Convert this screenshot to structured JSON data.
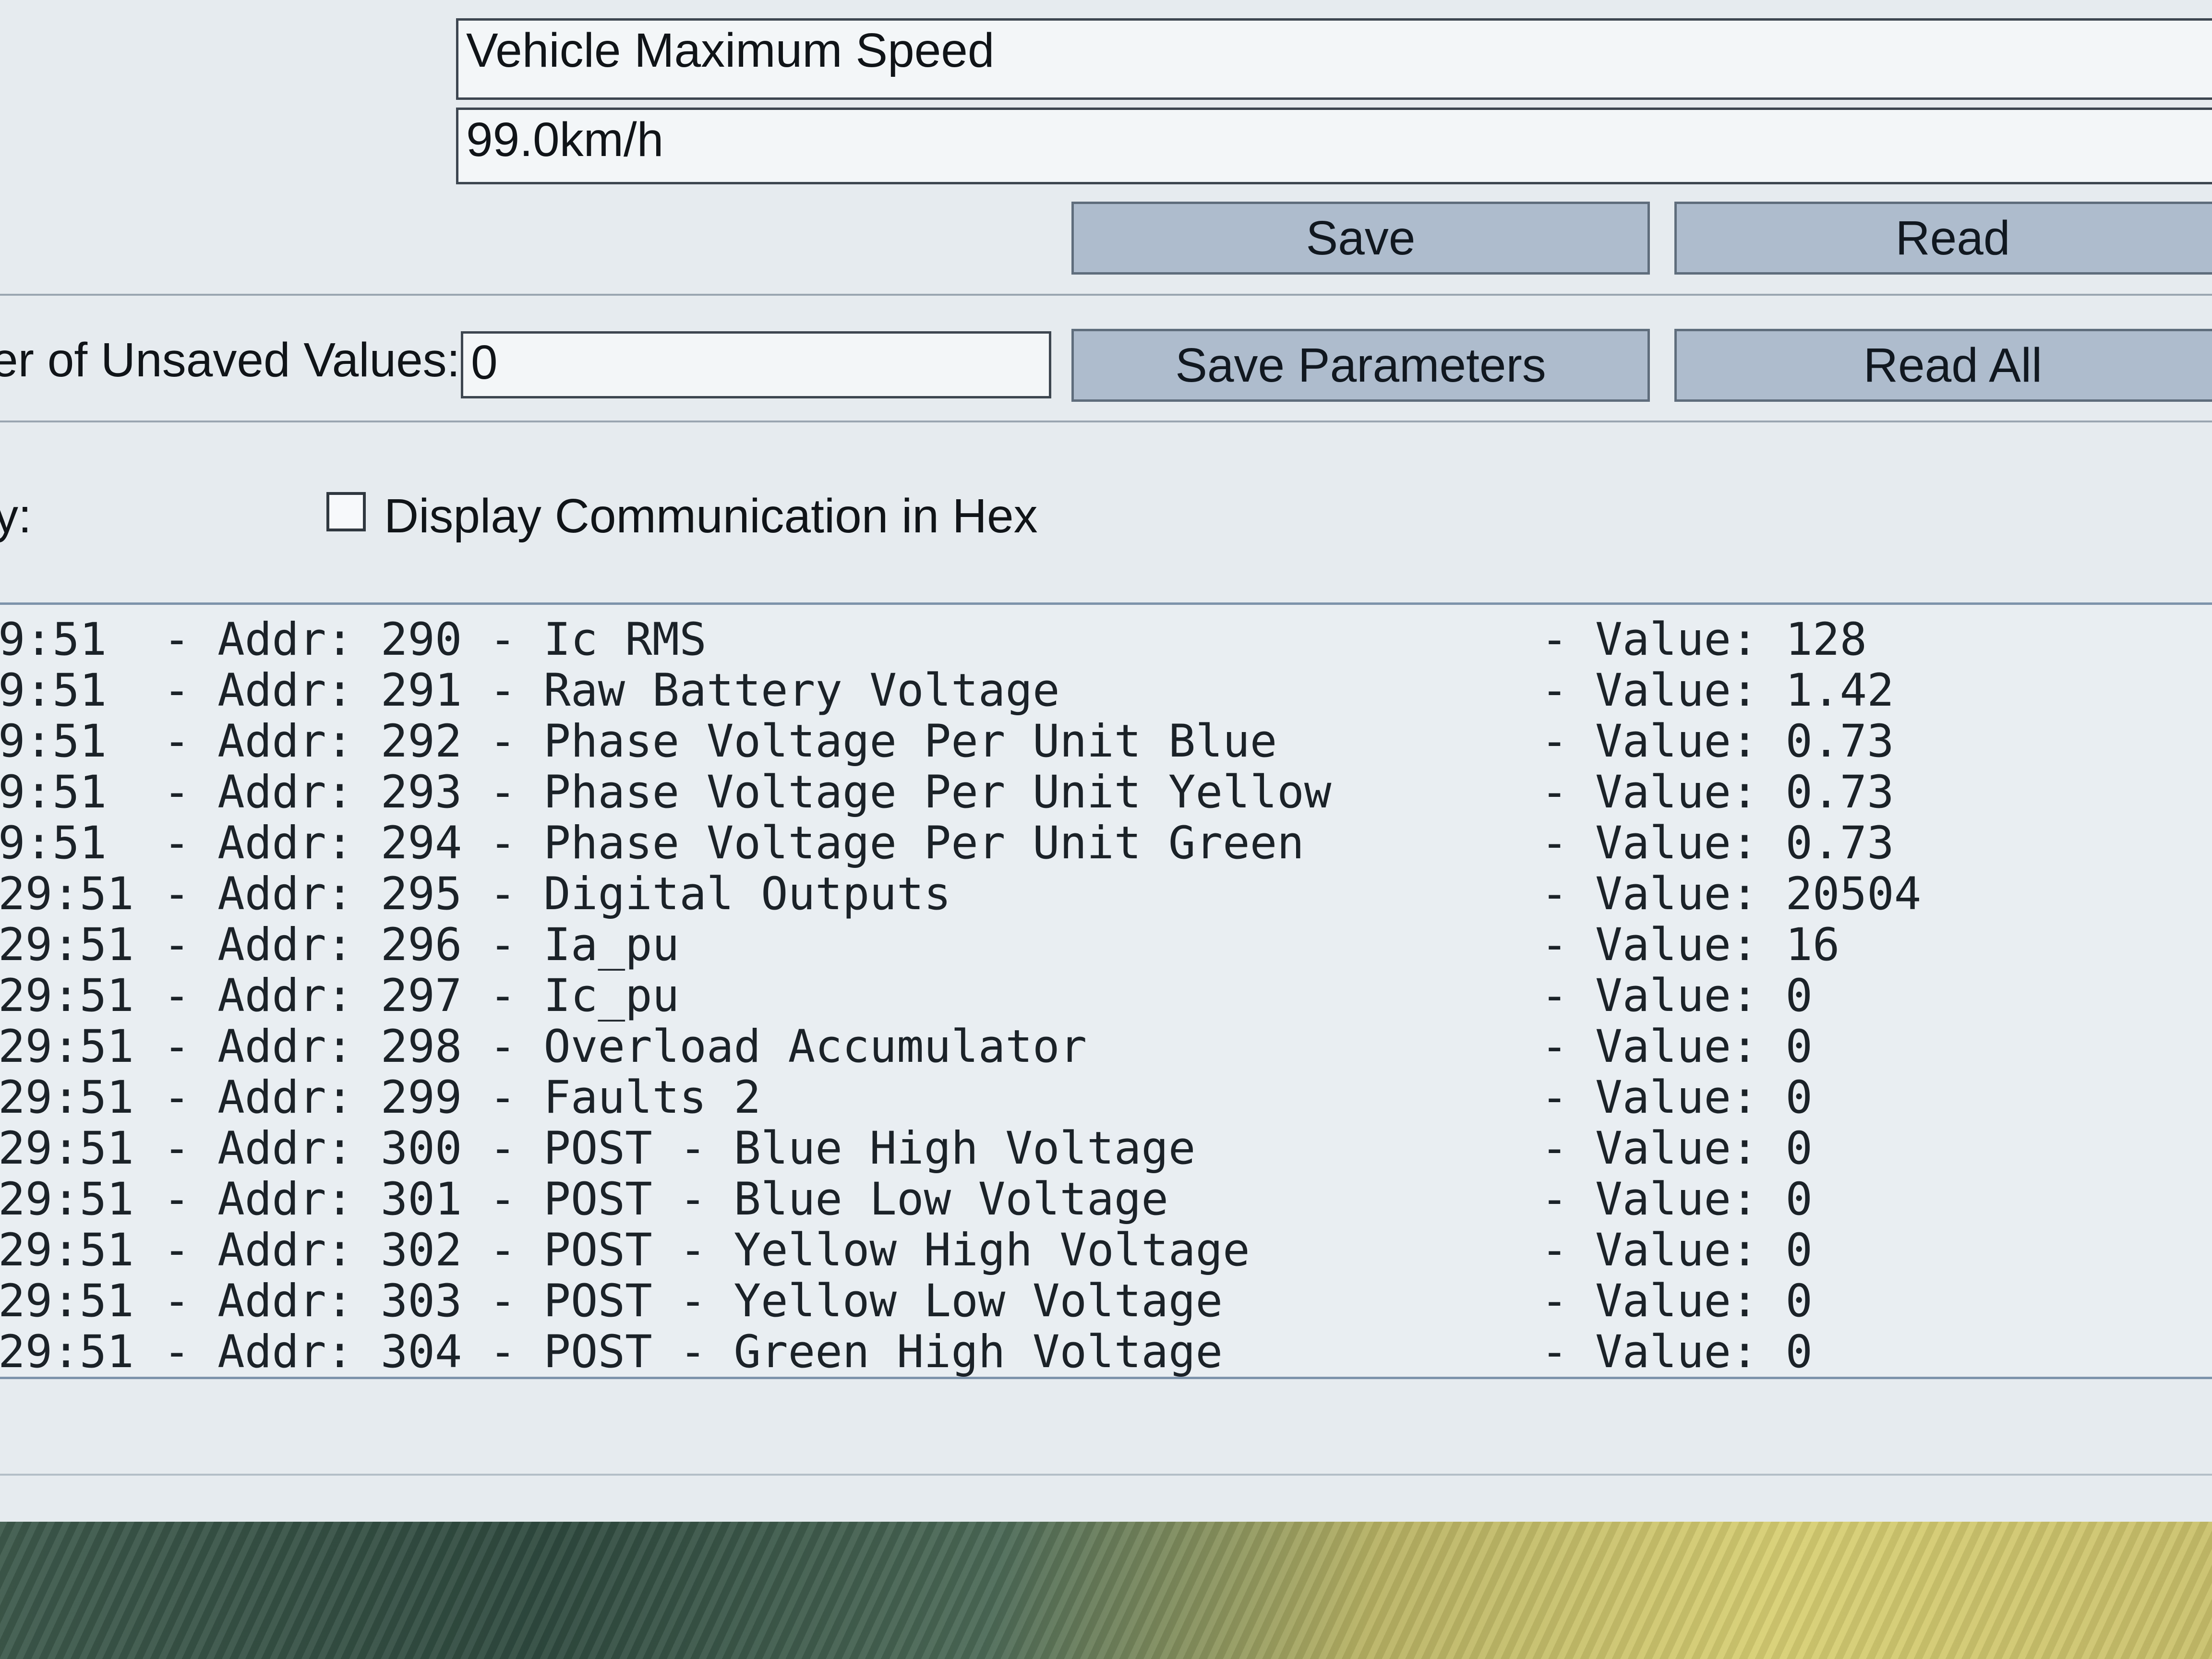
{
  "parameter": {
    "name": "Vehicle Maximum Speed",
    "value": "99.0km/h"
  },
  "buttons": {
    "save": "Save",
    "read": "Read",
    "save_parameters": "Save Parameters",
    "read_all": "Read All"
  },
  "unsaved": {
    "label": "er of Unsaved Values:",
    "value": "0"
  },
  "communication": {
    "label": "y:",
    "hex_checkbox_label": "Display Communication in Hex",
    "hex_checked": false
  },
  "log": [
    {
      "time": "9:51",
      "addr": "- Addr: 290 - Ic RMS",
      "value": "- Value: 128"
    },
    {
      "time": "9:51",
      "addr": "- Addr: 291 - Raw Battery Voltage",
      "value": "- Value: 1.42"
    },
    {
      "time": "9:51",
      "addr": "- Addr: 292 - Phase Voltage Per Unit Blue",
      "value": "- Value: 0.73"
    },
    {
      "time": "9:51",
      "addr": "- Addr: 293 - Phase Voltage Per Unit Yellow",
      "value": "- Value: 0.73"
    },
    {
      "time": "9:51",
      "addr": "- Addr: 294 - Phase Voltage Per Unit Green",
      "value": "- Value: 0.73"
    },
    {
      "time": "29:51",
      "addr": "- Addr: 295 - Digital Outputs",
      "value": "- Value: 20504"
    },
    {
      "time": "29:51",
      "addr": "- Addr: 296 - Ia_pu",
      "value": "- Value: 16"
    },
    {
      "time": "29:51",
      "addr": "- Addr: 297 - Ic_pu",
      "value": "- Value: 0"
    },
    {
      "time": "29:51",
      "addr": "- Addr: 298 - Overload Accumulator",
      "value": "- Value: 0"
    },
    {
      "time": "29:51",
      "addr": "- Addr: 299 - Faults 2",
      "value": "- Value: 0"
    },
    {
      "time": "29:51",
      "addr": "- Addr: 300 - POST - Blue High Voltage",
      "value": "- Value: 0"
    },
    {
      "time": "29:51",
      "addr": "- Addr: 301 - POST - Blue Low Voltage",
      "value": "- Value: 0"
    },
    {
      "time": "29:51",
      "addr": "- Addr: 302 - POST - Yellow High Voltage",
      "value": "- Value: 0"
    },
    {
      "time": "29:51",
      "addr": "- Addr: 303 - POST - Yellow Low Voltage",
      "value": "- Value: 0"
    },
    {
      "time": "29:51",
      "addr": "- Addr: 304 - POST - Green High Voltage",
      "value": "- Value: 0"
    }
  ]
}
